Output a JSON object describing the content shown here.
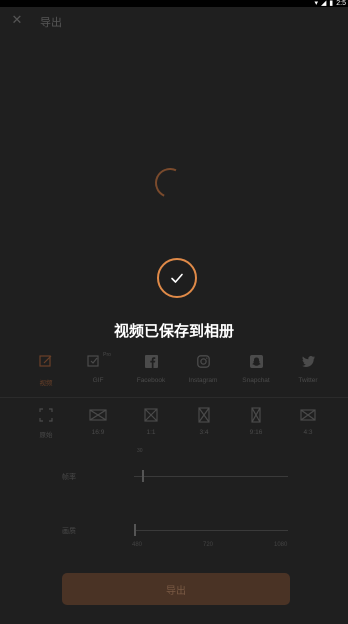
{
  "status": {
    "time": "2:5"
  },
  "header": {
    "title": "导出"
  },
  "toast": {
    "message": "视频已保存到相册"
  },
  "formats": [
    {
      "label": "视频",
      "icon": "edit-icon",
      "active": true
    },
    {
      "label": "GIF",
      "icon": "gif-icon",
      "badge": "Pro"
    },
    {
      "label": "Facebook",
      "icon": "facebook-icon"
    },
    {
      "label": "Instagram",
      "icon": "instagram-icon"
    },
    {
      "label": "Snapchat",
      "icon": "snapchat-icon"
    },
    {
      "label": "Twitter",
      "icon": "twitter-icon"
    }
  ],
  "ratios": [
    {
      "label": "原始",
      "icon": "fullscreen-icon"
    },
    {
      "label": "16:9",
      "icon": "ratio-16-9-icon"
    },
    {
      "label": "1:1",
      "icon": "ratio-1-1-icon"
    },
    {
      "label": "3:4",
      "icon": "ratio-3-4-icon"
    },
    {
      "label": "9:16",
      "icon": "ratio-9-16-icon"
    },
    {
      "label": "4:3",
      "icon": "ratio-4-3-icon"
    }
  ],
  "fps": {
    "label": "帧率",
    "value_label": "30",
    "fraction": 0.05
  },
  "resolution": {
    "label": "画质",
    "ticks": [
      "480",
      "720",
      "1080"
    ],
    "fraction": 0.0
  },
  "export_button": {
    "label": "导出"
  },
  "colors": {
    "accent": "#e08a48",
    "background": "#1f1f1f"
  }
}
